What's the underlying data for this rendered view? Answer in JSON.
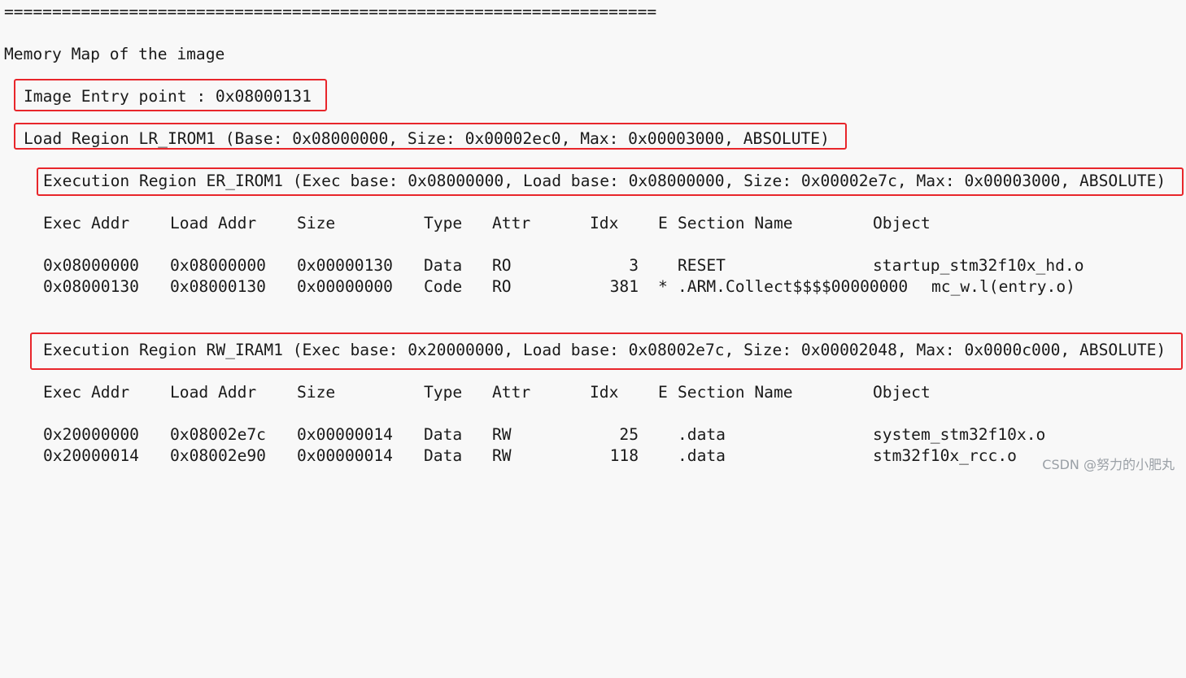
{
  "separator": "====================================================================",
  "title": "Memory Map of the image",
  "entry_point": "Image Entry point : 0x08000131",
  "load_region": "Load Region LR_IROM1 (Base: 0x08000000, Size: 0x00002ec0, Max: 0x00003000, ABSOLUTE)",
  "exec_regions": [
    {
      "header": "Execution Region ER_IROM1 (Exec base: 0x08000000, Load base: 0x08000000, Size: 0x00002e7c, Max: 0x00003000, ABSOLUTE)",
      "rows": [
        {
          "exec": "0x08000000",
          "load": "0x08000000",
          "size": "0x00000130",
          "type": "Data",
          "attr": "RO",
          "idx": "3",
          "e": "",
          "section": "RESET",
          "object": "startup_stm32f10x_hd.o"
        },
        {
          "exec": "0x08000130",
          "load": "0x08000130",
          "size": "0x00000000",
          "type": "Code",
          "attr": "RO",
          "idx": "381",
          "e": "*",
          "section": ".ARM.Collect$$$$00000000",
          "object": "mc_w.l(entry.o)"
        }
      ]
    },
    {
      "header": "Execution Region RW_IRAM1 (Exec base: 0x20000000, Load base: 0x08002e7c, Size: 0x00002048, Max: 0x0000c000, ABSOLUTE)",
      "rows": [
        {
          "exec": "0x20000000",
          "load": "0x08002e7c",
          "size": "0x00000014",
          "type": "Data",
          "attr": "RW",
          "idx": "25",
          "e": "",
          "section": ".data",
          "object": "system_stm32f10x.o"
        },
        {
          "exec": "0x20000014",
          "load": "0x08002e90",
          "size": "0x00000014",
          "type": "Data",
          "attr": "RW",
          "idx": "118",
          "e": "",
          "section": ".data",
          "object": "stm32f10x_rcc.o"
        }
      ]
    }
  ],
  "columns": {
    "exec": "Exec Addr",
    "load": "Load Addr",
    "size": "Size",
    "type": "Type",
    "attr": "Attr",
    "idx": "Idx",
    "e": "E",
    "section": "Section Name",
    "object": "Object"
  },
  "watermark": "CSDN @努力的小肥丸",
  "highlight_color": "#e8262b"
}
